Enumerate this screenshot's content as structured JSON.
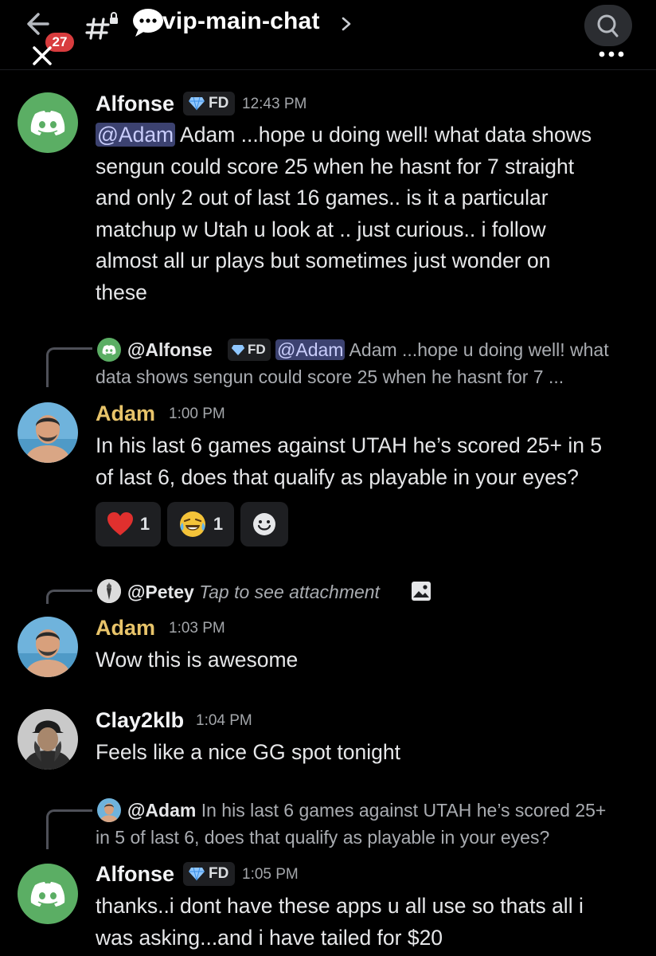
{
  "header": {
    "unread_count": "27",
    "channel_name": "vip-main-chat",
    "icons": [
      "back-arrow-icon",
      "close-icon",
      "hash-lock-icon",
      "speech-bubble-icon",
      "chevron-right-icon",
      "search-icon",
      "more-icon"
    ]
  },
  "colors": {
    "background": "#000000",
    "mention_bg": "#3c4270",
    "discord_green": "#5bae64",
    "badge_red": "#d83c3e",
    "username_gold": "#e8c46a"
  },
  "messages": [
    {
      "author": "Alfonse",
      "tag": "FD",
      "time": "12:43 PM",
      "mention": "@Adam",
      "lines": [
        " Adam ...hope u doing well!  what data shows",
        "sengun could score 25 when he hasnt for 7 straight",
        "and only 2 out of last 16 games.. is it a particular",
        "matchup w Utah u look at .. just curious.. i follow",
        "almost all ur plays but sometimes just wonder on",
        "these"
      ]
    },
    {
      "reply": {
        "author": "@Alfonse",
        "tag": "FD",
        "mention": "@Adam",
        "line1": " Adam ...hope u doing well!  what",
        "line2": "data shows sengun could score 25 when he hasnt for 7 ..."
      },
      "author": "Adam",
      "time": "1:00 PM",
      "lines": [
        "In his last 6 games against UTAH he’s scored 25+ in 5",
        "of last 6, does that qualify as playable in your eyes?"
      ],
      "reactions": [
        {
          "emoji": "❤️",
          "count": "1"
        },
        {
          "emoji": "😂",
          "count": "1"
        }
      ]
    },
    {
      "reply": {
        "author": "@Petey",
        "text": "Tap to see attachment"
      },
      "author": "Adam",
      "time": "1:03 PM",
      "lines": [
        "Wow this is awesome"
      ]
    },
    {
      "author": "Clay2klb",
      "time": "1:04 PM",
      "lines": [
        "Feels like a nice GG spot tonight"
      ]
    },
    {
      "reply": {
        "author": "@Adam",
        "line1": " In his last 6 games against UTAH he’s scored 25+",
        "line2": "in 5 of last 6, does that qualify as playable in your eyes?"
      },
      "author": "Alfonse",
      "tag": "FD",
      "time": "1:05 PM",
      "lines": [
        "thanks..i dont have these apps u all use so thats all i",
        "was asking...and i have tailed for $20"
      ]
    }
  ]
}
